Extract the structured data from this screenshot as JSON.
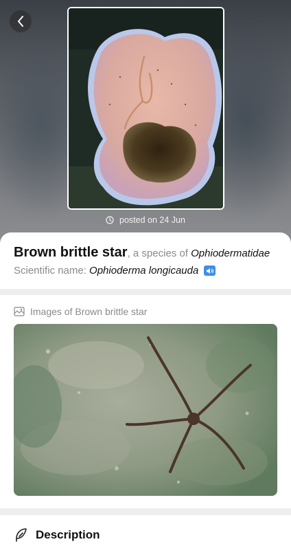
{
  "header": {
    "back_icon": "chevron-left-icon",
    "posted_icon": "clock-icon",
    "posted_text": "posted on 24 Jun"
  },
  "species": {
    "common_name": "Brown brittle star",
    "species_of_prefix": ", a species of ",
    "family": "Ophiodermatidae",
    "scientific_label": "Scientific name: ",
    "scientific_name": "Ophioderma longicauda",
    "audio_icon": "speaker-icon",
    "audio_color": "#3f8fe6"
  },
  "images_section": {
    "icon": "image-gallery-icon",
    "title": "Images of Brown brittle star"
  },
  "description_section": {
    "icon": "feather-icon",
    "title": "Description"
  }
}
